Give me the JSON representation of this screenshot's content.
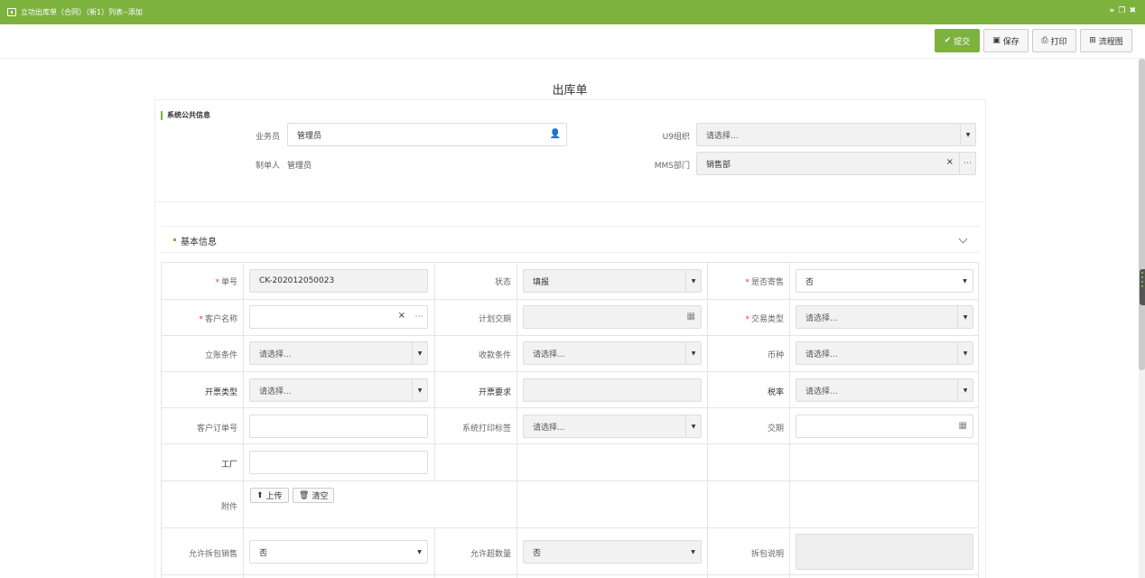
{
  "window": {
    "title": "立功出库单（合同）（新1）列表--添加",
    "controls": [
      "»",
      "❐",
      "✖"
    ]
  },
  "toolbar": {
    "submit_label": "提交",
    "save_label": "保存",
    "print_label": "打印",
    "flow_label": "流程图"
  },
  "form": {
    "title": "出库单"
  },
  "public_info": {
    "section_title": "系统公共信息",
    "salesman_label": "业务员",
    "salesman_value": "管理员",
    "u9_org_label": "U9组织",
    "u9_org_placeholder": "请选择...",
    "creator_label": "制单人",
    "creator_value": "管理员",
    "mms_dept_label": "MMS部门",
    "mms_dept_value": "销售部"
  },
  "base_info": {
    "section_title": "基本信息",
    "order_no_label": "单号",
    "order_no_value": "CK-202012050023",
    "status_label": "状态",
    "status_value": "填报",
    "consign_label": "是否寄售",
    "consign_value": "否",
    "customer_label": "客户名称",
    "customer_value": "",
    "plan_date_label": "计划交期",
    "plan_date_value": "",
    "trade_type_label": "交易类型",
    "trade_type_placeholder": "请选择...",
    "account_cond_label": "立账条件",
    "account_cond_placeholder": "请选择...",
    "receipt_cond_label": "收款条件",
    "receipt_cond_placeholder": "请选择...",
    "currency_label": "币种",
    "currency_placeholder": "请选择...",
    "invoice_type_label": "开票类型",
    "invoice_type_placeholder": "请选择...",
    "invoice_req_label": "开票要求",
    "invoice_req_value": "",
    "tax_rate_label": "税率",
    "tax_rate_placeholder": "请选择...",
    "cust_order_label": "客户订单号",
    "cust_order_value": "",
    "print_tag_label": "系统打印标签",
    "print_tag_placeholder": "请选择...",
    "delivery_label": "交期",
    "delivery_value": "",
    "factory_label": "工厂",
    "factory_value": "",
    "attach_label": "附件",
    "upload_label": "上传",
    "clear_label": "清空",
    "split_sale_label": "允许拆包销售",
    "split_sale_value": "否",
    "over_qty_label": "允许超数量",
    "over_qty_value": "否",
    "split_note_label": "拆包说明",
    "split_note_value": ""
  },
  "colors": {
    "accent": "#7db23f",
    "required": "#e4393c"
  }
}
